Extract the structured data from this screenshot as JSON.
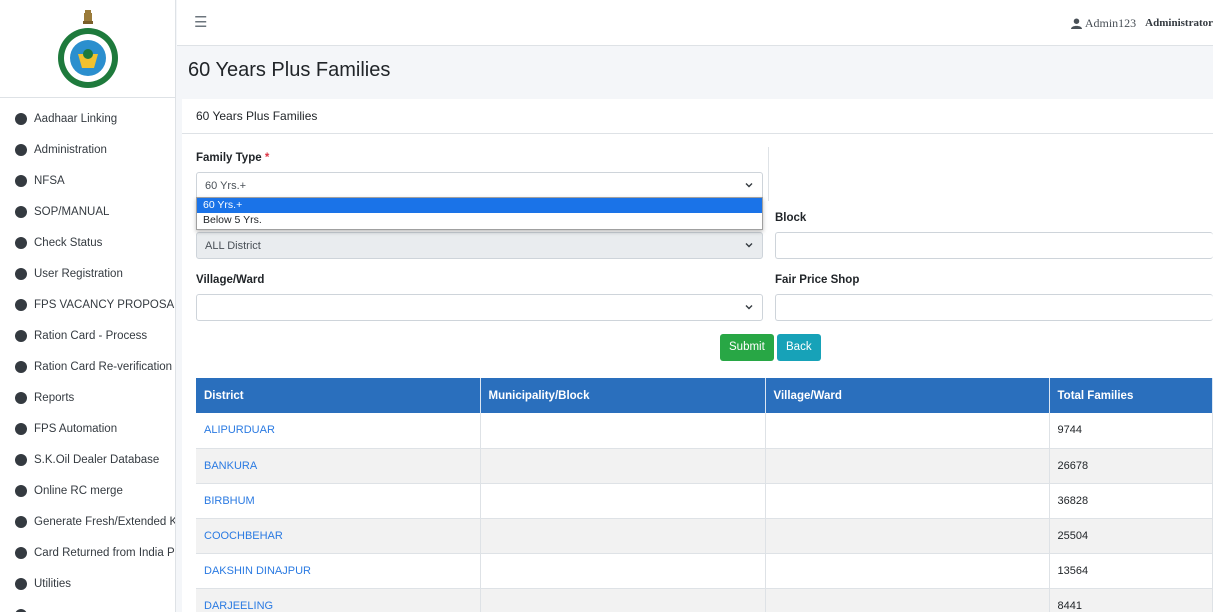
{
  "sidebar": {
    "items": [
      {
        "label": "Aadhaar Linking"
      },
      {
        "label": "Administration"
      },
      {
        "label": "NFSA"
      },
      {
        "label": "SOP/MANUAL"
      },
      {
        "label": "Check Status"
      },
      {
        "label": "User Registration"
      },
      {
        "label": "FPS VACANCY PROPOSAL"
      },
      {
        "label": "Ration Card - Process"
      },
      {
        "label": "Ration Card Re-verification"
      },
      {
        "label": "Reports"
      },
      {
        "label": "FPS Automation"
      },
      {
        "label": "S.K.Oil Dealer Database"
      },
      {
        "label": "Online RC merge"
      },
      {
        "label": "Generate Fresh/Extended Kh"
      },
      {
        "label": "Card Returned from India Po"
      },
      {
        "label": "Utilities"
      }
    ]
  },
  "topbar": {
    "hamburger_icon": "☰",
    "user_name": "Admin123",
    "user_role": "Administrator"
  },
  "page": {
    "title": "60 Years Plus Families",
    "card_title": "60 Years Plus Families"
  },
  "form": {
    "family_type_label": "Family Type",
    "required_mark": "*",
    "family_type_value": "60 Yrs.+",
    "family_type_options": [
      "60 Yrs.+",
      "Below 5 Yrs."
    ],
    "district_value": "ALL District",
    "block_label": "Block",
    "village_label": "Village/Ward",
    "fps_label": "Fair Price Shop",
    "submit_label": "Submit",
    "back_label": "Back"
  },
  "table": {
    "headers": [
      "District",
      "Municipality/Block",
      "Village/Ward",
      "Total Families"
    ],
    "rows": [
      {
        "district": "ALIPURDUAR",
        "block": "",
        "village": "",
        "total": "9744"
      },
      {
        "district": "BANKURA",
        "block": "",
        "village": "",
        "total": "26678"
      },
      {
        "district": "BIRBHUM",
        "block": "",
        "village": "",
        "total": "36828"
      },
      {
        "district": "COOCHBEHAR",
        "block": "",
        "village": "",
        "total": "25504"
      },
      {
        "district": "DAKSHIN DINAJPUR",
        "block": "",
        "village": "",
        "total": "13564"
      },
      {
        "district": "DARJEELING",
        "block": "",
        "village": "",
        "total": "8441"
      }
    ]
  },
  "colors": {
    "table_header": "#2a6fbd",
    "link": "#2a7ae2",
    "submit": "#28a745",
    "back": "#17a2b8"
  }
}
